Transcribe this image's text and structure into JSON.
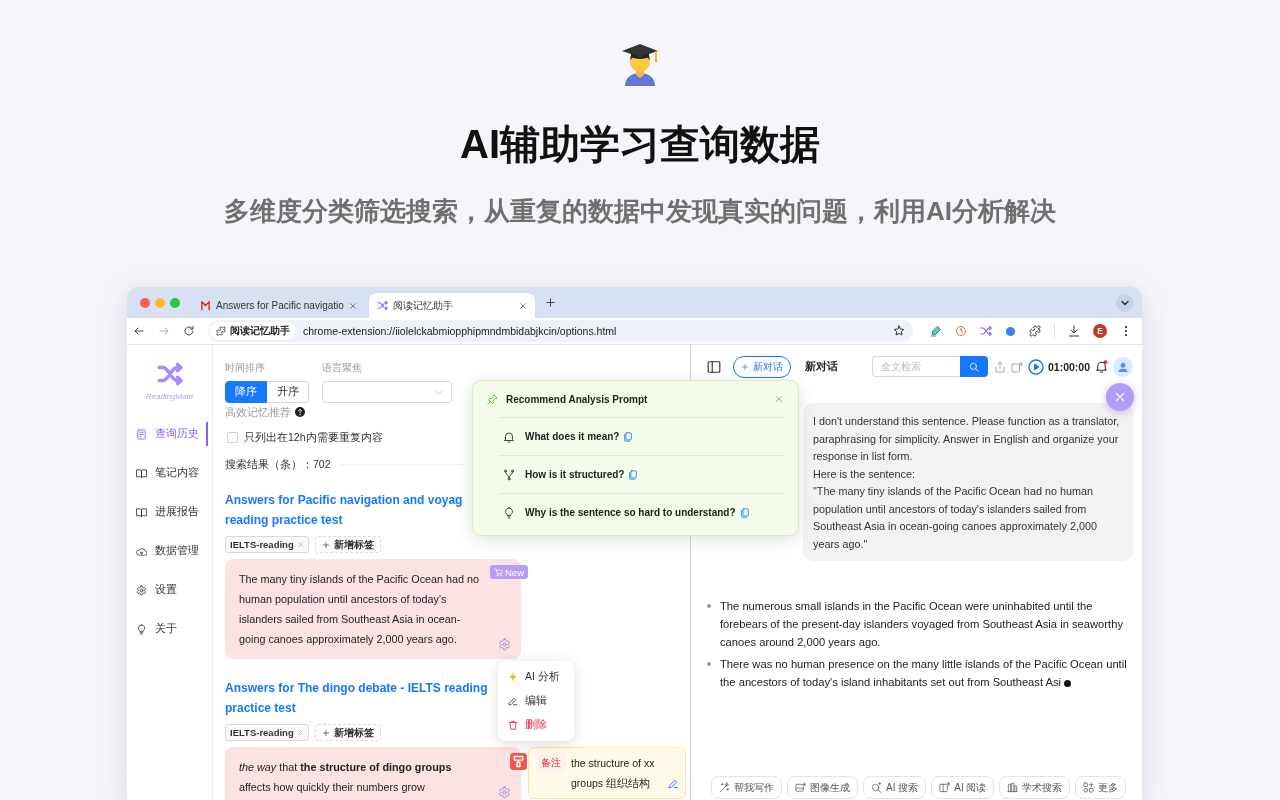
{
  "hero": {
    "title": "AI辅助学习查询数据",
    "subtitle": "多维度分类筛选搜索，从重复的数据中发现真实的问题，利用AI分析解决"
  },
  "browser": {
    "tabs": [
      {
        "kind": "site",
        "title": "Answers for Pacific navigatio",
        "selected": false
      },
      {
        "kind": "extension",
        "title": "阅读记忆助手",
        "selected": true
      }
    ],
    "address": {
      "chip": "阅读记忆助手",
      "url": "chrome-extension://iiolelckabmiopphipmndmbidabjkcin/options.html"
    },
    "profile_initial": "E"
  },
  "sidebar": {
    "brand": "ReadingMate",
    "items": [
      {
        "label": "查询历史",
        "selected": true
      },
      {
        "label": "笔记内容",
        "selected": false
      },
      {
        "label": "进展报告",
        "selected": false
      },
      {
        "label": "数据管理",
        "selected": false
      },
      {
        "label": "设置",
        "selected": false
      },
      {
        "label": "关于",
        "selected": false
      }
    ]
  },
  "filters": {
    "sort": {
      "label": "时间排序",
      "options": [
        {
          "label": "降序",
          "selected": true
        },
        {
          "label": "升序",
          "selected": false
        }
      ]
    },
    "language": {
      "label": "语言聚焦"
    },
    "recommend": {
      "label": "高效记忆推荐"
    },
    "only_due": {
      "label": "只列出在12h内需要重复内容",
      "checked": false
    }
  },
  "results": "搜索结果（条）：702",
  "entries": [
    {
      "title_lines": [
        "Answers for Pacific navigation and voyag",
        "reading practice test"
      ],
      "tags": [
        "IELTS-reading"
      ],
      "add_tag": "新增标签",
      "excerpt": "The many tiny islands of the Pacific Ocean had no human population until ancestors of today’s islanders sailed from Southeast Asia in ocean-going canoes approximately 2,000 years ago.",
      "badge": {
        "kind": "new",
        "label": "New"
      }
    },
    {
      "title_lines": [
        "Answers for The dingo debate - IELTS reading",
        "practice test"
      ],
      "tags": [
        "IELTS-reading"
      ],
      "add_tag": "新增标签",
      "excerpt": "*the way* that **the structure of dingo groups** affects how quickly their numbers grow",
      "badge": {
        "kind": "highlight"
      },
      "note": {
        "label": "备注",
        "text": "the structure of xx groups 组织结构"
      }
    }
  ],
  "context_menu": {
    "items": [
      {
        "kind": "ai",
        "label": "AI 分析"
      },
      {
        "kind": "edit",
        "label": "编辑"
      },
      {
        "kind": "delete",
        "label": "删除"
      }
    ]
  },
  "prompt_popup": {
    "title": "Recommend Analysis Prompt",
    "items": [
      "What does it mean?",
      "How is it structured?",
      "Why is the sentence so hard to understand?"
    ]
  },
  "chat": {
    "header": {
      "new_chat": "新对话",
      "title": "新对话",
      "search_placeholder": "全文检索",
      "timer": "01:00:00",
      "unread": true
    },
    "user_message": "I don't understand this sentence. Please function as a translator, paraphrasing for simplicity. Answer in English and organize your response in list form.\nHere is the sentence:\n\"The many tiny islands of the Pacific Ocean had no human population until ancestors of today's islanders sailed from Southeast Asia in ocean-going canoes approximately 2,000 years ago.\"",
    "answer": [
      "The numerous small islands in the Pacific Ocean were uninhabited until the forebears of the present-day islanders voyaged from Southeast Asia in seaworthy canoes around 2,000 years ago.",
      "There was no human presence on the many little islands of the Pacific Ocean until the ancestors of today's island inhabitants set out from Southeast Asi"
    ],
    "streaming": true,
    "tools": [
      "帮我写作",
      "图像生成",
      "AI 搜索",
      "AI 阅读",
      "学术搜索",
      "更多"
    ]
  }
}
